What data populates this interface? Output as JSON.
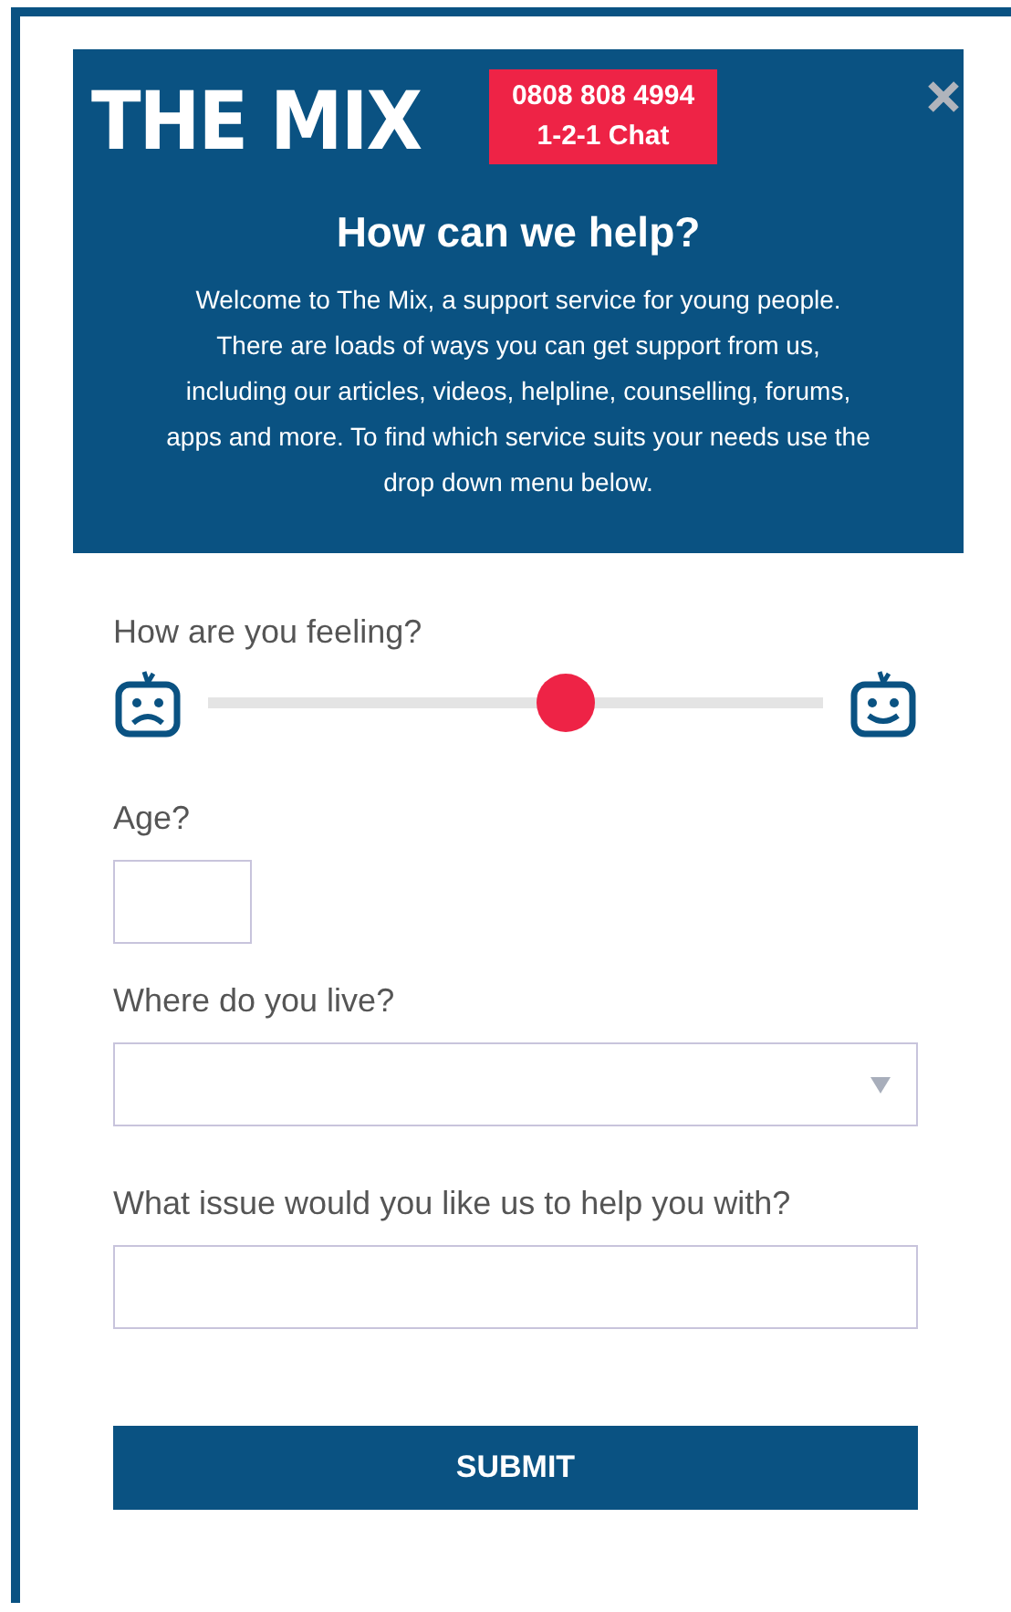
{
  "header": {
    "logo": "THE MIX",
    "phone": "0808 808 4994",
    "chat": "1-2-1 Chat",
    "title": "How can we help?",
    "intro": "Welcome to The Mix, a support service for young people. There are loads of ways you can get support from us, including our articles, videos, helpline, counselling, forums, apps and more. To find which service suits your needs use the drop down menu below."
  },
  "form": {
    "feeling": {
      "label": "How are you feeling?",
      "level": 0.59
    },
    "age": {
      "label": "Age?"
    },
    "location": {
      "label": "Where do you live?"
    },
    "issue": {
      "label": "What issue would you like us to help you with?"
    },
    "submit": "SUBMIT"
  }
}
